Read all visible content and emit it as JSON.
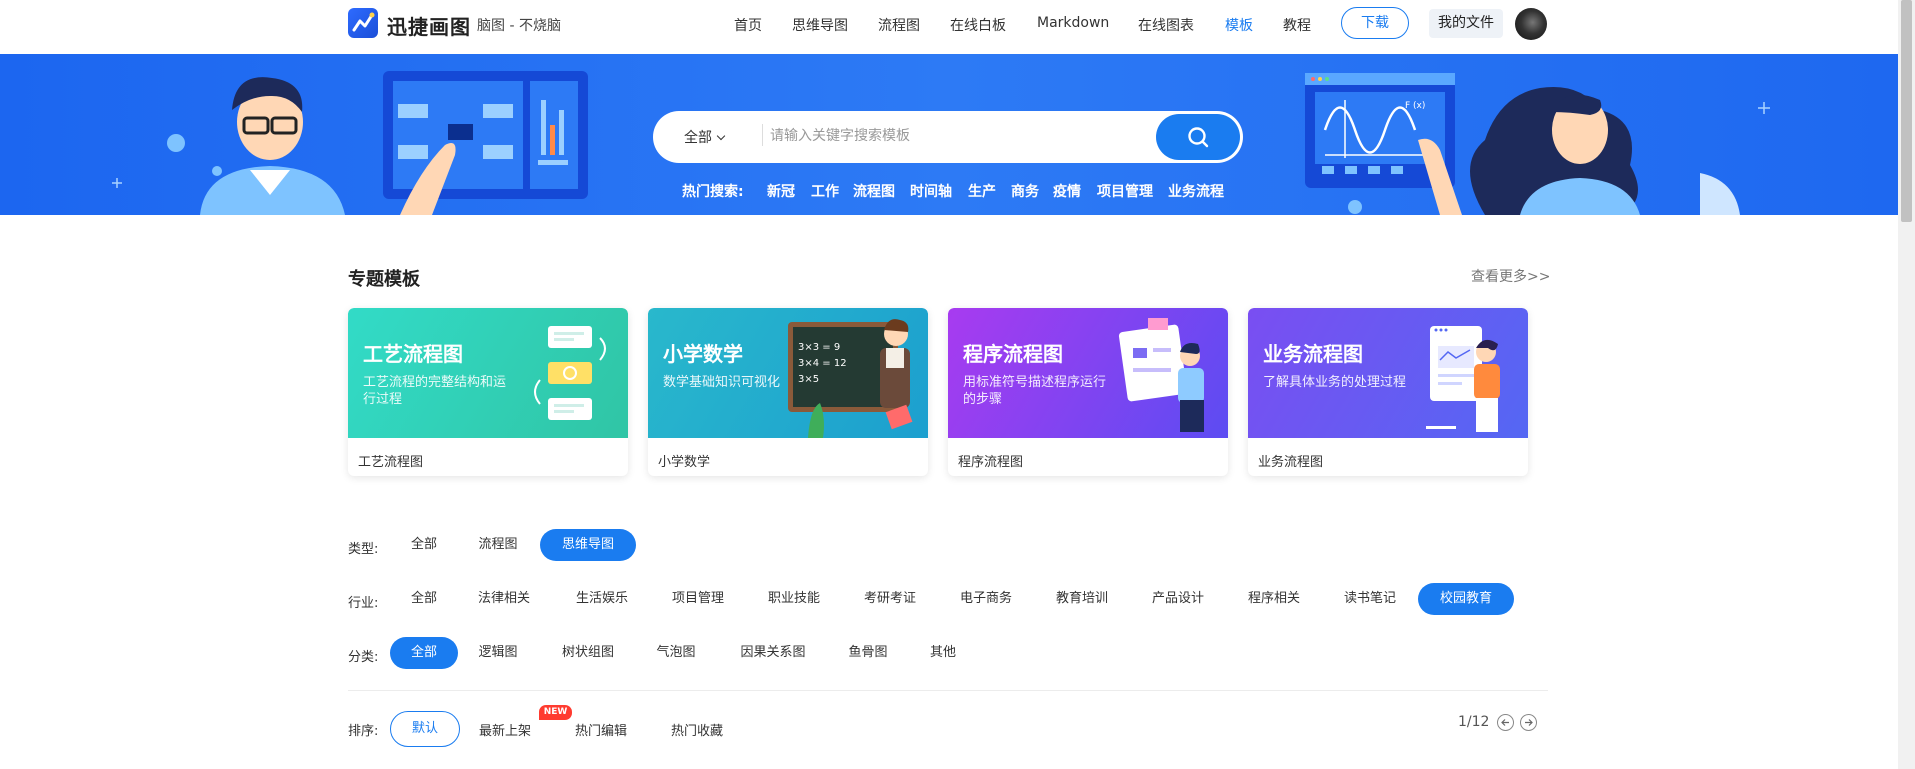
{
  "header": {
    "brand": "迅捷画图",
    "slogan": "脑图 - 不烧脑",
    "nav": [
      "首页",
      "思维导图",
      "流程图",
      "在线白板",
      "Markdown",
      "在线图表",
      "模板",
      "教程"
    ],
    "active_nav": "模板",
    "download_label": "下载",
    "my_files_label": "我的文件"
  },
  "search": {
    "scope": "全部",
    "placeholder": "请输入关键字搜索模板",
    "hot_label": "热门搜索:",
    "hot_items": [
      "新冠",
      "工作",
      "流程图",
      "时间轴",
      "生产",
      "商务",
      "疫情",
      "项目管理",
      "业务流程"
    ]
  },
  "topic": {
    "title": "专题模板",
    "see_more": "查看更多>>",
    "cards": [
      {
        "title": "工艺流程图",
        "desc": "工艺流程的完整结构和运行过程",
        "caption": "工艺流程图",
        "color_from": "#2fd6c1",
        "color_to": "#34c9a6"
      },
      {
        "title": "小学数学",
        "desc": "数学基础知识可视化",
        "caption": "小学数学",
        "color_from": "#27b6c8",
        "color_to": "#1e9fd0"
      },
      {
        "title": "程序流程图",
        "desc": "用标准符号描述程序运行的步骤",
        "caption": "程序流程图",
        "color_from": "#a23af0",
        "color_to": "#5f4bf0"
      },
      {
        "title": "业务流程图",
        "desc": "了解具体业务的处理过程",
        "caption": "业务流程图",
        "color_from": "#7b4df2",
        "color_to": "#5566f3"
      }
    ],
    "board_text": [
      "3×3 = 9",
      "3×4 = 12",
      "3×5"
    ],
    "chart_label": "F (x)"
  },
  "filters": {
    "type_label": "类型:",
    "types": [
      "全部",
      "流程图",
      "思维导图"
    ],
    "active_type": "思维导图",
    "industry_label": "行业:",
    "industries": [
      "全部",
      "法律相关",
      "生活娱乐",
      "项目管理",
      "职业技能",
      "考研考证",
      "电子商务",
      "教育培训",
      "产品设计",
      "程序相关",
      "读书笔记",
      "校园教育"
    ],
    "active_industry": "校园教育",
    "category_label": "分类:",
    "categories": [
      "全部",
      "逻辑图",
      "树状组图",
      "气泡图",
      "因果关系图",
      "鱼骨图",
      "其他"
    ],
    "active_category": "全部",
    "sort_label": "排序:",
    "sorts": [
      "默认",
      "最新上架",
      "热门编辑",
      "热门收藏"
    ],
    "new_badge": "NEW",
    "pager": "1/12"
  },
  "colors": {
    "accent": "#1a7cf0",
    "banner": "#1c66f0",
    "badge": "#ff3b30"
  }
}
